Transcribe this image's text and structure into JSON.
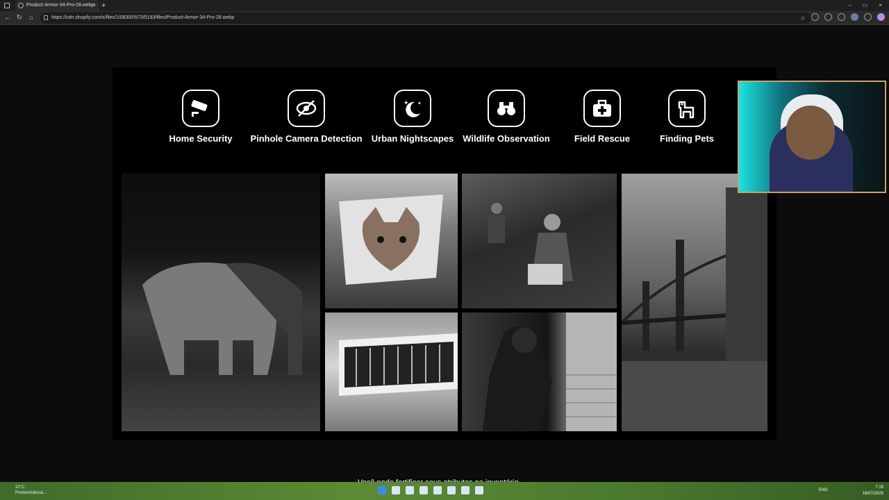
{
  "browser": {
    "tab_title": "Product-Armor-34-Pro-28.webp",
    "tab_close": "×",
    "new_tab": "+",
    "url": "https://cdn.shopify.com/s/files/1/0830/0573/5193/files/Product-Armor-34-Pro-28.webp",
    "window_controls": [
      "–",
      "▭",
      "×"
    ]
  },
  "features": [
    {
      "label": "Home Security",
      "icon": "security-camera-icon"
    },
    {
      "label": "Pinhole Camera Detection",
      "icon": "eye-slash-icon"
    },
    {
      "label": "Urban Nightscapes",
      "icon": "moon-stars-icon"
    },
    {
      "label": "Wildlife Observation",
      "icon": "binoculars-icon"
    },
    {
      "label": "Field Rescue",
      "icon": "first-aid-kit-icon"
    },
    {
      "label": "Finding Pets",
      "icon": "dog-icon"
    }
  ],
  "photos": [
    "elephant herd at night",
    "cat hiding in paper bag",
    "rescue team in field",
    "bridge and city street at night",
    "ceiling air vent",
    "burglar at door"
  ],
  "caption": "Você pode fortificar seus atributos no inventário.",
  "taskbar": {
    "weather_temp": "22°C",
    "weather_desc": "Predominância...",
    "lang": "ENG",
    "time": "7:19",
    "date": "16/07/2025"
  },
  "colors": {
    "accent": "#c9a46a",
    "page_bg": "#000000",
    "chrome_bg": "#2b2b2b"
  }
}
